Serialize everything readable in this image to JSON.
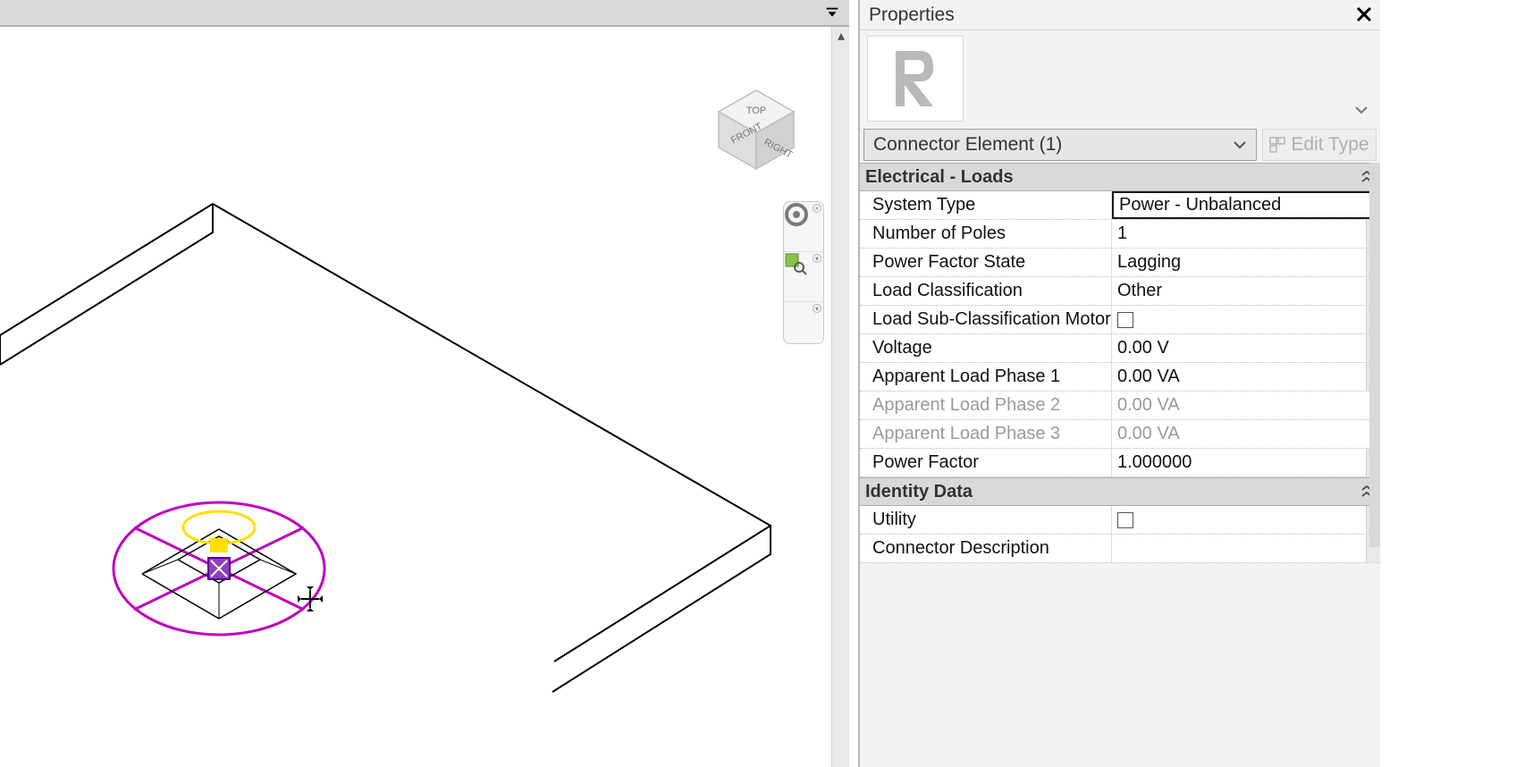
{
  "panel_title": "Properties",
  "type_selector": {
    "text": "Connector Element (1)",
    "edit_type_label": "Edit Type"
  },
  "viewcube": {
    "top": "TOP",
    "front": "FRONT",
    "right": "RIGHT"
  },
  "sections": {
    "electrical_loads": {
      "title": "Electrical - Loads",
      "rows": {
        "system_type": {
          "label": "System Type",
          "value": "Power - Unbalanced"
        },
        "number_of_poles": {
          "label": "Number of Poles",
          "value": "1"
        },
        "power_factor_state": {
          "label": "Power Factor State",
          "value": "Lagging"
        },
        "load_classification": {
          "label": "Load Classification",
          "value": "Other"
        },
        "load_subclass": {
          "label": "Load Sub-Classification Motor",
          "value": ""
        },
        "voltage": {
          "label": "Voltage",
          "value": "0.00 V"
        },
        "apparent_load_p1": {
          "label": "Apparent Load Phase 1",
          "value": "0.00 VA"
        },
        "apparent_load_p2": {
          "label": "Apparent Load Phase 2",
          "value": "0.00 VA"
        },
        "apparent_load_p3": {
          "label": "Apparent Load Phase 3",
          "value": "0.00 VA"
        },
        "power_factor": {
          "label": "Power Factor",
          "value": "1.000000"
        }
      }
    },
    "identity_data": {
      "title": "Identity Data",
      "rows": {
        "utility": {
          "label": "Utility",
          "value": ""
        },
        "connector_desc": {
          "label": "Connector Description",
          "value": ""
        }
      }
    }
  }
}
